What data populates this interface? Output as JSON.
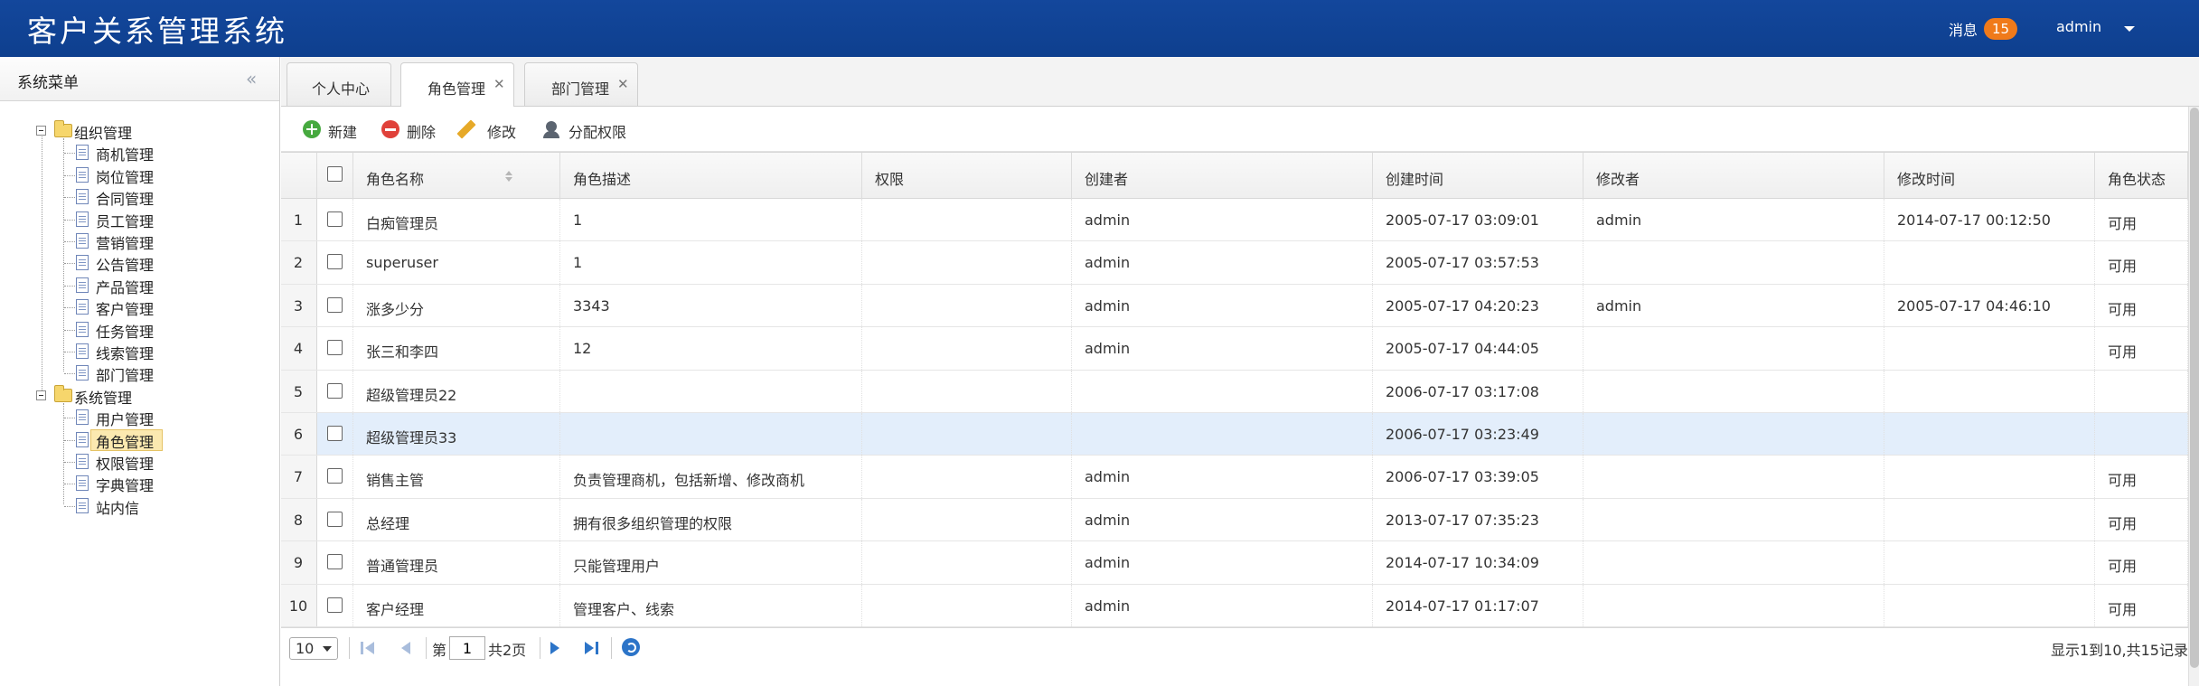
{
  "header": {
    "app_title": "客户关系管理系统",
    "messages_label": "消息",
    "messages_count": "15",
    "user_name": "admin",
    "colors": {
      "header_bg": "#13479c",
      "badge": "#f07a1a"
    }
  },
  "sidebar": {
    "title": "系统菜单",
    "collapse_icon": "double-chevron-left-icon",
    "groups": [
      {
        "label": "组织管理",
        "items": [
          "商机管理",
          "岗位管理",
          "合同管理",
          "员工管理",
          "营销管理",
          "公告管理",
          "产品管理",
          "客户管理",
          "任务管理",
          "线索管理",
          "部门管理"
        ]
      },
      {
        "label": "系统管理",
        "items": [
          "用户管理",
          "角色管理",
          "权限管理",
          "字典管理",
          "站内信"
        ]
      }
    ],
    "selected_item": "角色管理"
  },
  "tabs": [
    {
      "label": "个人中心",
      "closable": false,
      "active": false
    },
    {
      "label": "角色管理",
      "closable": true,
      "active": true
    },
    {
      "label": "部门管理",
      "closable": true,
      "active": false
    }
  ],
  "toolbar": {
    "add_label": "新建",
    "delete_label": "删除",
    "edit_label": "修改",
    "assign_label": "分配权限"
  },
  "grid": {
    "columns": [
      "角色名称",
      "角色描述",
      "权限",
      "创建者",
      "创建时间",
      "修改者",
      "修改时间",
      "角色状态"
    ],
    "rows": [
      {
        "num": "1",
        "name": "白痴管理员",
        "desc": "1",
        "perm": "",
        "creator": "admin",
        "created": "2005-07-17 03:09:01",
        "modifier": "admin",
        "modified": "2014-07-17 00:12:50",
        "status": "可用"
      },
      {
        "num": "2",
        "name": "superuser",
        "desc": "1",
        "perm": "",
        "creator": "admin",
        "created": "2005-07-17 03:57:53",
        "modifier": "",
        "modified": "",
        "status": "可用"
      },
      {
        "num": "3",
        "name": "涨多少分",
        "desc": "3343",
        "perm": "",
        "creator": "admin",
        "created": "2005-07-17 04:20:23",
        "modifier": "admin",
        "modified": "2005-07-17 04:46:10",
        "status": "可用"
      },
      {
        "num": "4",
        "name": "张三和李四",
        "desc": "12",
        "perm": "",
        "creator": "admin",
        "created": "2005-07-17 04:44:05",
        "modifier": "",
        "modified": "",
        "status": "可用"
      },
      {
        "num": "5",
        "name": "超级管理员22",
        "desc": "",
        "perm": "",
        "creator": "",
        "created": "2006-07-17 03:17:08",
        "modifier": "",
        "modified": "",
        "status": ""
      },
      {
        "num": "6",
        "name": "超级管理员33",
        "desc": "",
        "perm": "",
        "creator": "",
        "created": "2006-07-17 03:23:49",
        "modifier": "",
        "modified": "",
        "status": ""
      },
      {
        "num": "7",
        "name": "销售主管",
        "desc": "负责管理商机，包括新增、修改商机",
        "perm": "",
        "creator": "admin",
        "created": "2006-07-17 03:39:05",
        "modifier": "",
        "modified": "",
        "status": "可用"
      },
      {
        "num": "8",
        "name": "总经理",
        "desc": "拥有很多组织管理的权限",
        "perm": "",
        "creator": "admin",
        "created": "2013-07-17 07:35:23",
        "modifier": "",
        "modified": "",
        "status": "可用"
      },
      {
        "num": "9",
        "name": "普通管理员",
        "desc": "只能管理用户",
        "perm": "",
        "creator": "admin",
        "created": "2014-07-17 10:34:09",
        "modifier": "",
        "modified": "",
        "status": "可用"
      },
      {
        "num": "10",
        "name": "客户经理",
        "desc": "管理客户、线索",
        "perm": "",
        "creator": "admin",
        "created": "2014-07-17 01:17:07",
        "modifier": "",
        "modified": "",
        "status": "可用"
      }
    ],
    "highlighted_row": "6"
  },
  "pager": {
    "page_size": "10",
    "page_prefix": "第",
    "current_page": "1",
    "page_suffix": "共2页",
    "info": "显示1到10,共15记录"
  }
}
